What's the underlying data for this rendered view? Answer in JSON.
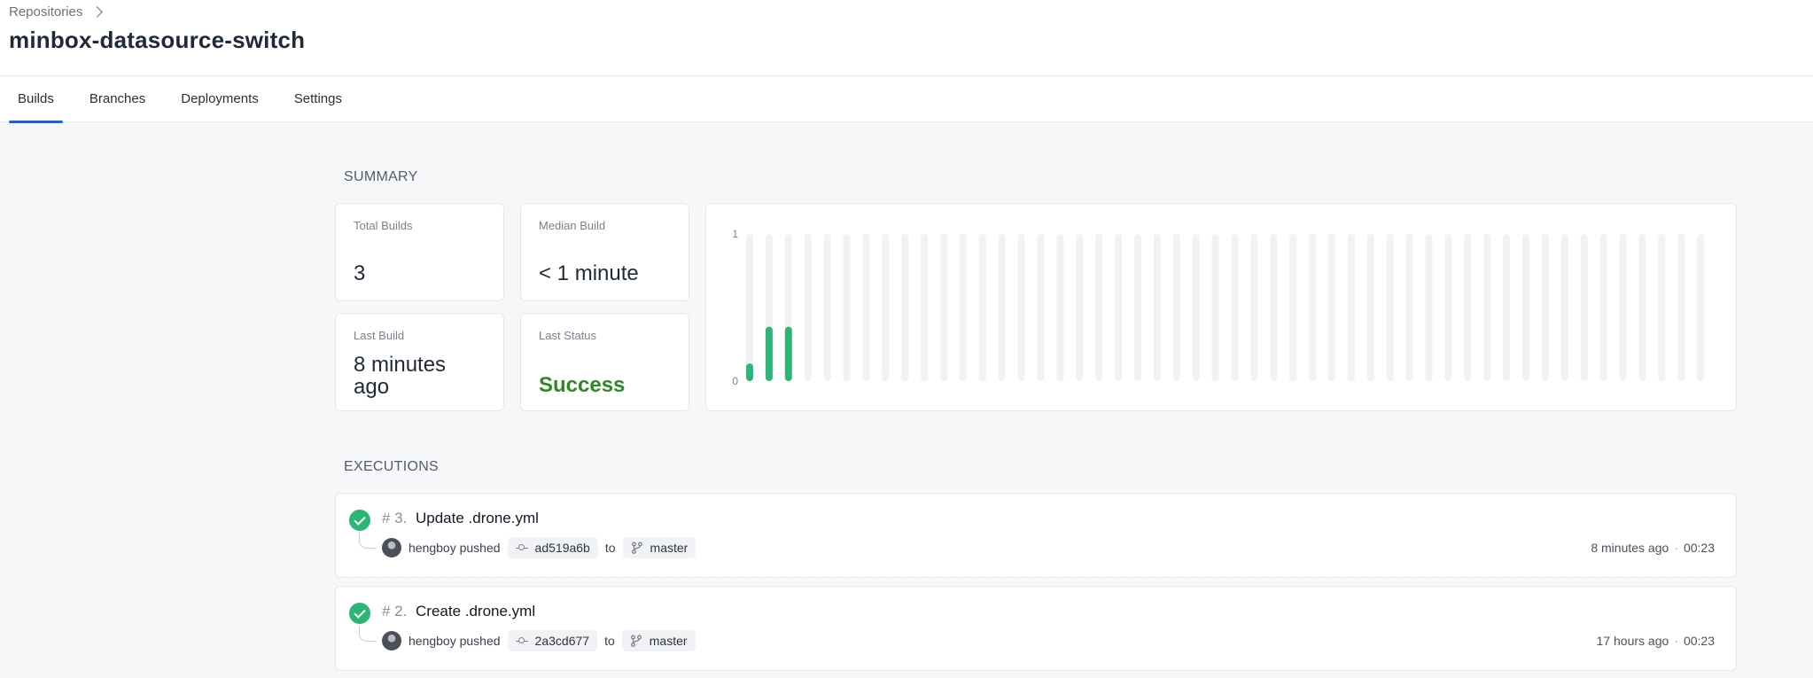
{
  "breadcrumb": {
    "parent": "Repositories"
  },
  "repo": {
    "title": "minbox-datasource-switch"
  },
  "tabs": [
    {
      "label": "Builds",
      "active": true
    },
    {
      "label": "Branches",
      "active": false
    },
    {
      "label": "Deployments",
      "active": false
    },
    {
      "label": "Settings",
      "active": false
    }
  ],
  "summary": {
    "heading": "SUMMARY",
    "total_builds": {
      "label": "Total Builds",
      "value": "3"
    },
    "median_build": {
      "label": "Median Build",
      "value": "< 1 minute"
    },
    "last_build": {
      "label": "Last Build",
      "value": "8 minutes ago"
    },
    "last_status": {
      "label": "Last Status",
      "value": "Success"
    }
  },
  "chart_data": {
    "type": "bar",
    "ylim": [
      0,
      1
    ],
    "yticks": [
      "1",
      "0"
    ],
    "slot_count": 50,
    "values": [
      0.12,
      0.37,
      0.37
    ],
    "bar_color": "#2bb673",
    "track_color": "#f1f2f6"
  },
  "executions": {
    "heading": "EXECUTIONS",
    "items": [
      {
        "number": "# 3.",
        "title": "Update .drone.yml",
        "author": "hengboy pushed",
        "commit": "ad519a6b",
        "to": "to",
        "branch": "master",
        "time": "8 minutes ago",
        "sep": "·",
        "duration": "00:23"
      },
      {
        "number": "# 2.",
        "title": "Create .drone.yml",
        "author": "hengboy pushed",
        "commit": "2a3cd677",
        "to": "to",
        "branch": "master",
        "time": "17 hours ago",
        "sep": "·",
        "duration": "00:23"
      }
    ]
  },
  "colors": {
    "accent": "#1b63d8",
    "success": "#2a8a23",
    "bar": "#2bb673"
  }
}
